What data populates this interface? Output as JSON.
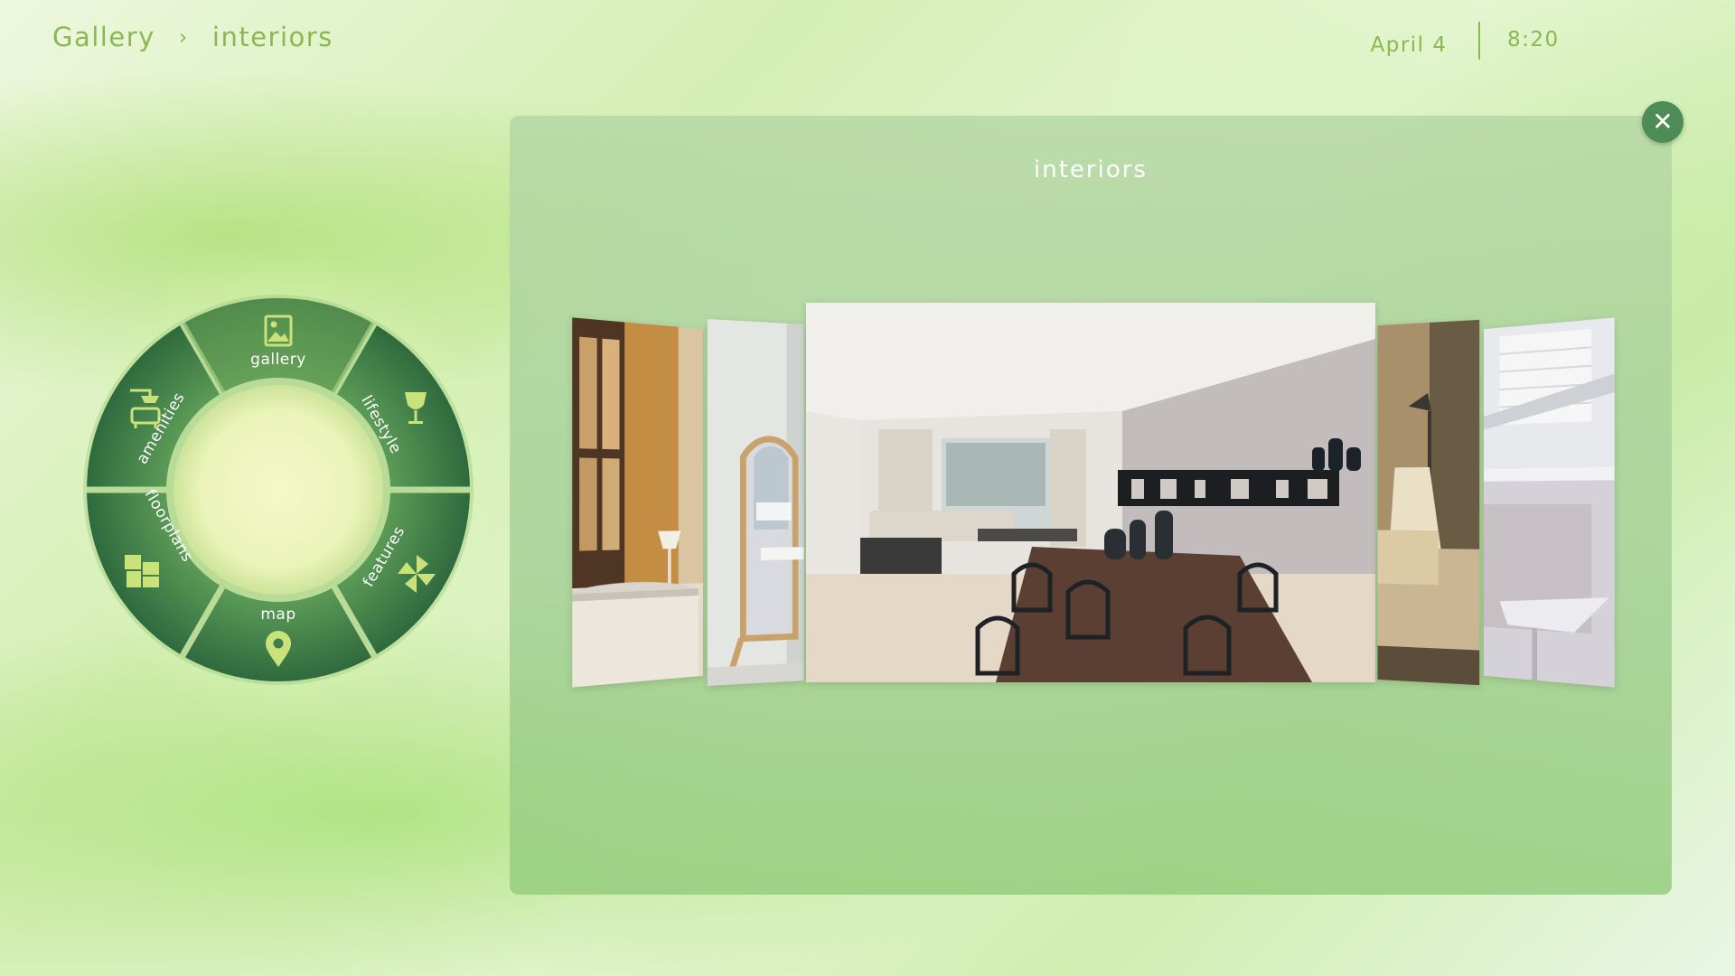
{
  "breadcrumb": {
    "root": "Gallery",
    "separator": "›",
    "current": "interiors"
  },
  "status": {
    "date": "April 4",
    "time": "8:20"
  },
  "panel": {
    "title": "interiors",
    "close_icon": "close-icon",
    "close_symbol": "✕"
  },
  "carousel": {
    "items": [
      {
        "name": "bedroom-lamp-photo"
      },
      {
        "name": "mirror-photo"
      },
      {
        "name": "dining-living-room-photo",
        "selected": true
      },
      {
        "name": "sofa-lamp-photo"
      },
      {
        "name": "kitchen-photo"
      }
    ]
  },
  "menu": {
    "items": [
      {
        "label": "gallery",
        "icon": "gallery-icon",
        "active": true
      },
      {
        "label": "lifestyle",
        "icon": "wine-glass-icon"
      },
      {
        "label": "features",
        "icon": "pinwheel-icon"
      },
      {
        "label": "map",
        "icon": "map-pin-icon"
      },
      {
        "label": "floorplans",
        "icon": "floorplan-icon"
      },
      {
        "label": "amenities",
        "icon": "shower-icon"
      }
    ]
  },
  "colors": {
    "accent": "#8bb850",
    "menu_dark": "#3f7e4c",
    "menu_light": "#6da556",
    "close_bg": "#4d8b57"
  }
}
